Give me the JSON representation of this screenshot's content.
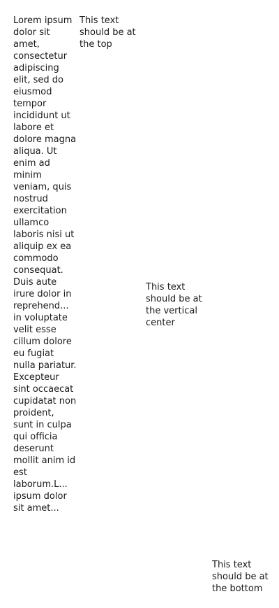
{
  "columns": {
    "lorem": "Lorem ipsum dolor sit amet, consectetur adipiscing elit, sed do eiusmod tempor incididunt ut labore et dolore magna aliqua. Ut enim ad minim veniam, quis nostrud exercitation ullamco laboris nisi ut aliquip ex ea commodo consequat. Duis aute irure dolor in reprehend... in voluptate velit esse cillum dolore eu fugiat nulla pariatur. Excepteur sint occaecat cupidatat non proident, sunt in culpa qui officia deserunt mollit anim id est laborum.L... ipsum dolor sit amet...",
    "top": "This text should be at the top",
    "center": "This text should be at the vertical center",
    "bottom": "This text should be at the bottom"
  }
}
